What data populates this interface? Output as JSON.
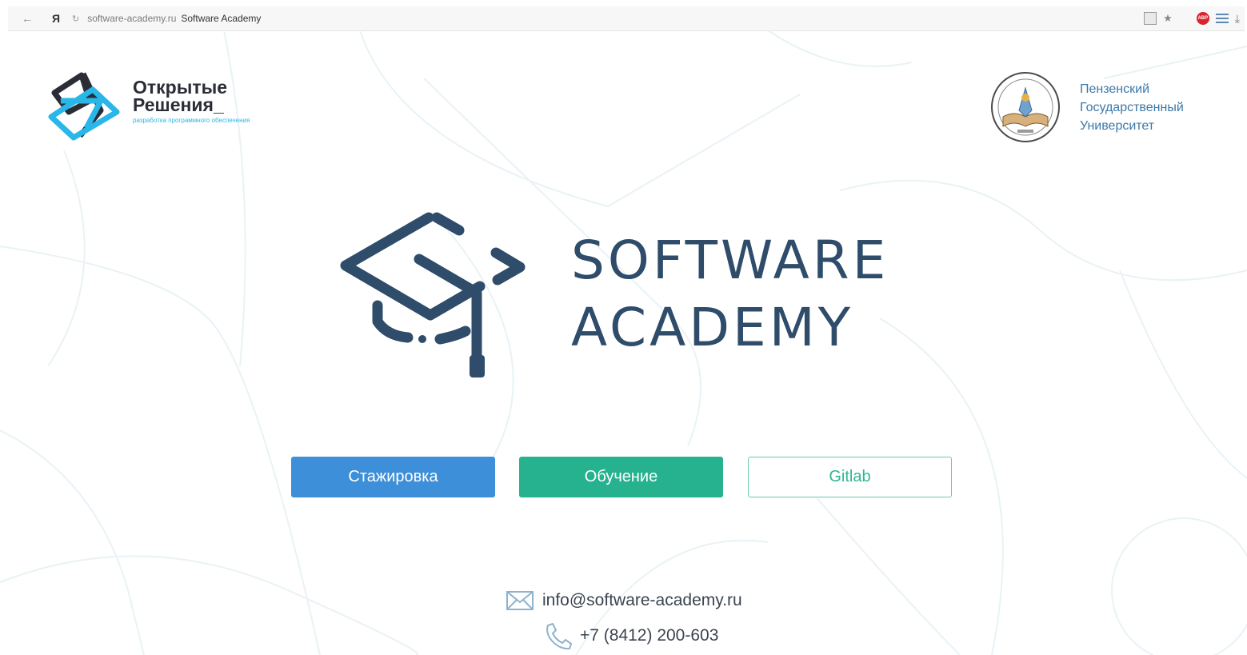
{
  "browser": {
    "back_icon": "←",
    "yandex_icon": "Я",
    "reload_icon": "↻",
    "url": "software-academy.ru",
    "page_title": "Software Academy"
  },
  "header": {
    "left_logo": {
      "line1": "Открытые",
      "line2": "Решения_",
      "subtitle": "разработка программного обеспечения"
    },
    "right_logo": {
      "line1": "Пензенский",
      "line2": "Государственный",
      "line3": "Университет"
    }
  },
  "hero": {
    "title_line1": "SOFTWARE",
    "title_line2": "ACADEMY"
  },
  "buttons": {
    "internship": "Стажировка",
    "learning": "Обучение",
    "gitlab": "Gitlab"
  },
  "contacts": {
    "email": "info@software-academy.ru",
    "phone": "+7 (8412) 200-603"
  },
  "colors": {
    "brand_dark": "#2f4d6a",
    "internship_button": "#3c8fd8",
    "learning_button": "#26b28f",
    "gitlab_text": "#2fb695",
    "university_text": "#3b78a8"
  }
}
